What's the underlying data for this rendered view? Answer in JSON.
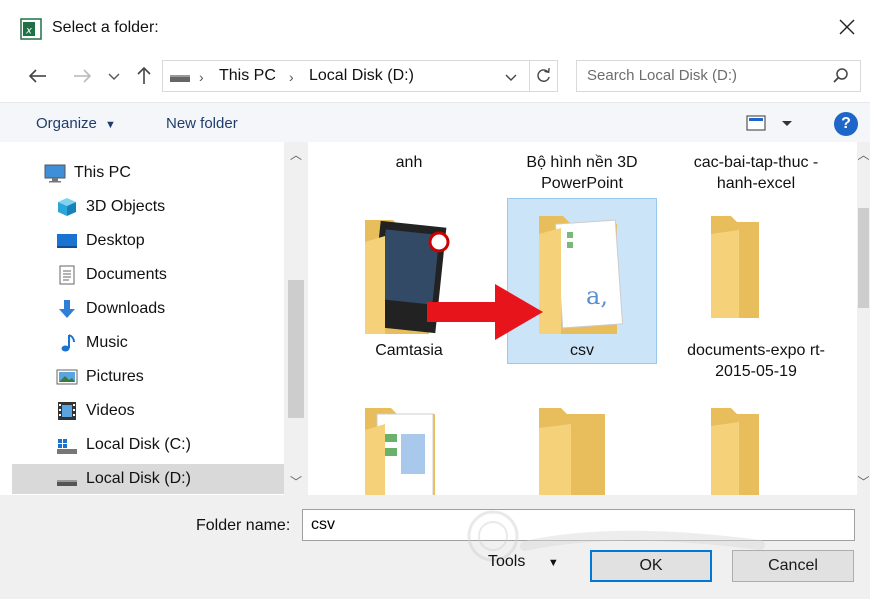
{
  "window": {
    "title": "Select a folder:"
  },
  "address": {
    "crumbs": [
      "This PC",
      "Local Disk (D:)"
    ]
  },
  "search": {
    "placeholder": "Search Local Disk (D:)"
  },
  "commands": {
    "organize": "Organize",
    "new_folder": "New folder",
    "help": "?"
  },
  "tree": [
    {
      "label": "This PC",
      "icon": "monitor-icon"
    },
    {
      "label": "3D Objects",
      "icon": "cube-icon"
    },
    {
      "label": "Desktop",
      "icon": "desktop-icon"
    },
    {
      "label": "Documents",
      "icon": "document-icon"
    },
    {
      "label": "Downloads",
      "icon": "download-arrow-icon"
    },
    {
      "label": "Music",
      "icon": "music-note-icon"
    },
    {
      "label": "Pictures",
      "icon": "picture-icon"
    },
    {
      "label": "Videos",
      "icon": "film-icon"
    },
    {
      "label": "Local Disk (C:)",
      "icon": "drive-windows-icon"
    },
    {
      "label": "Local Disk (D:)",
      "icon": "drive-icon",
      "selected": true
    }
  ],
  "folders": {
    "top_labels": [
      "anh",
      "Bộ hình nền 3D PowerPoint",
      "cac-bai-tap-thuc -hanh-excel"
    ],
    "row2": [
      "Camtasia",
      "csv",
      "documents-expo rt-2015-05-19"
    ]
  },
  "footer": {
    "folder_name_label": "Folder name:",
    "folder_name_value": "csv",
    "tools": "Tools",
    "ok": "OK",
    "cancel": "Cancel"
  },
  "colors": {
    "accent": "#0078d7",
    "selection": "#cce4f7",
    "folder": "#f5d27a",
    "arrow": "#e8141b"
  }
}
